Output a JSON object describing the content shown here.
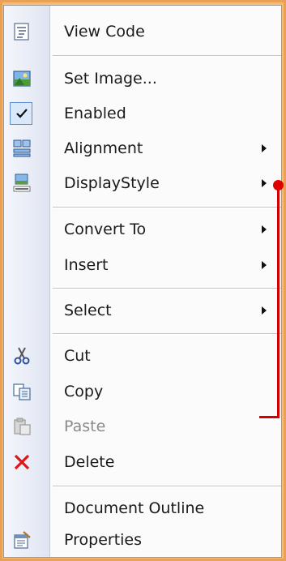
{
  "menu": {
    "items": [
      {
        "label": "View Code",
        "icon": "view-code-icon"
      },
      {
        "label": "Set Image...",
        "icon": "image-icon"
      },
      {
        "label": "Enabled",
        "icon": "checkmark-icon"
      },
      {
        "label": "Alignment",
        "icon": "alignment-icon"
      },
      {
        "label": "DisplayStyle",
        "icon": "display-style-icon"
      },
      {
        "label": "Convert To"
      },
      {
        "label": "Insert"
      },
      {
        "label": "Select"
      },
      {
        "label": "Cut",
        "icon": "scissors-icon"
      },
      {
        "label": "Copy",
        "icon": "copy-icon"
      },
      {
        "label": "Paste",
        "icon": "paste-icon"
      },
      {
        "label": "Delete",
        "icon": "delete-icon"
      },
      {
        "label": "Document Outline"
      },
      {
        "label": "Properties",
        "icon": "properties-icon"
      }
    ]
  },
  "colors": {
    "accent_annotation": "#d40000",
    "frame": "#f3b266",
    "menu_background": "#fbfbfb",
    "gutter": "#e8ecf6",
    "disabled_text": "#8a8a8a"
  }
}
